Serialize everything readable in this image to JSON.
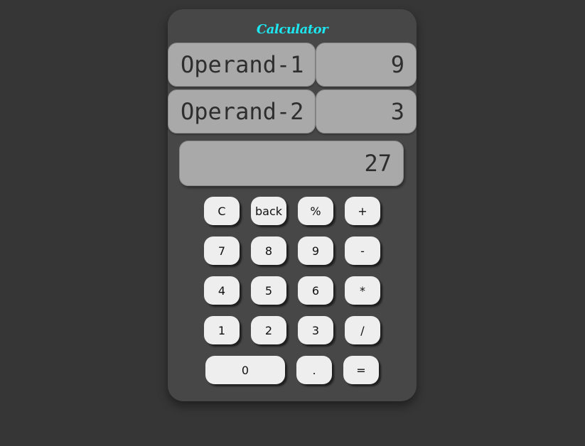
{
  "title": "Calculator",
  "operand1": {
    "label": "Operand-1",
    "value": "9"
  },
  "operand2": {
    "label": "Operand-2",
    "value": "3"
  },
  "result": "27",
  "buttons": {
    "clear": "C",
    "back": "back",
    "percent": "%",
    "add": "+",
    "seven": "7",
    "eight": "8",
    "nine": "9",
    "subtract": "-",
    "four": "4",
    "five": "5",
    "six": "6",
    "multiply": "*",
    "one": "1",
    "two": "2",
    "three": "3",
    "divide": "/",
    "zero": "0",
    "decimal": ".",
    "equals": "="
  },
  "colors": {
    "page_background": "#363636",
    "calculator_body": "#474747",
    "title": "#1de6f0",
    "display_field": "#a9a9a9",
    "button": "#eeeeee"
  }
}
